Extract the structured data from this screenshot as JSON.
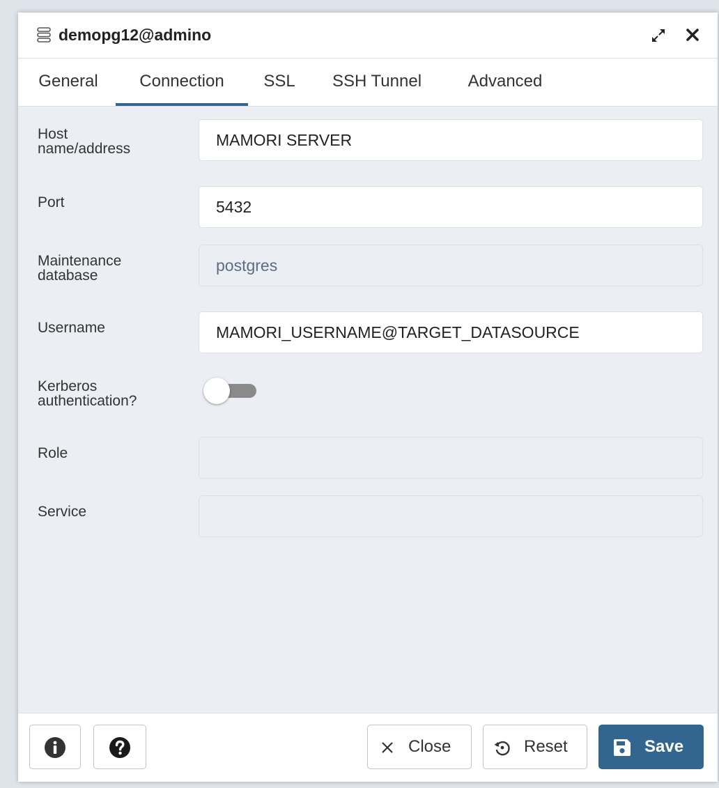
{
  "window": {
    "title": "demopg12@admino",
    "icons": {
      "server": "server-icon",
      "maximize": "maximize-icon",
      "close": "close-icon"
    }
  },
  "tabs": [
    {
      "label": "General",
      "active": false
    },
    {
      "label": "Connection",
      "active": true
    },
    {
      "label": "SSL",
      "active": false
    },
    {
      "label": "SSH Tunnel",
      "active": false
    },
    {
      "label": "Advanced",
      "active": false
    }
  ],
  "form": {
    "host": {
      "label_line1": "Host",
      "label_line2": "name/address",
      "value": "MAMORI SERVER"
    },
    "port": {
      "label": "Port",
      "value": "5432"
    },
    "maintenance_db": {
      "label_line1": "Maintenance",
      "label_line2": "database",
      "value": "postgres",
      "disabled": true
    },
    "username": {
      "label": "Username",
      "value": "MAMORI_USERNAME@TARGET_DATASOURCE"
    },
    "kerberos": {
      "label_line1": "Kerberos",
      "label_line2": "authentication?",
      "enabled": false
    },
    "role": {
      "label": "Role",
      "value": "",
      "disabled": true
    },
    "service": {
      "label": "Service",
      "value": "",
      "disabled": true
    }
  },
  "footer": {
    "info_icon": "info-icon",
    "help_icon": "help-icon",
    "close_label": "Close",
    "reset_label": "Reset",
    "save_label": "Save"
  },
  "colors": {
    "accent": "#326690",
    "background": "#ebeef3",
    "toggle_off": "#8a8a8a"
  }
}
